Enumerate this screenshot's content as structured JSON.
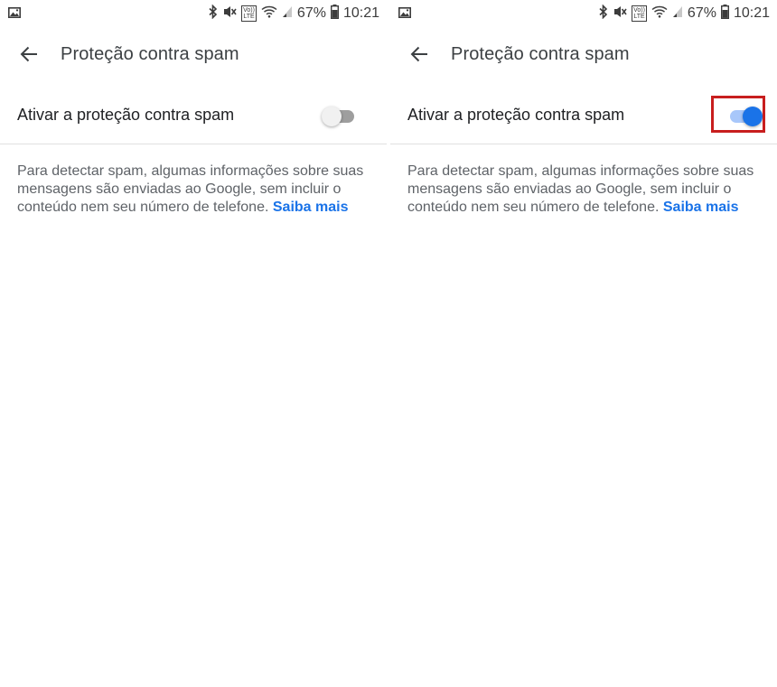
{
  "status_bar": {
    "battery_percent": "67%",
    "time": "10:21",
    "volte_top": "Vo))",
    "volte_bottom": "LTE",
    "icons": [
      "image-notification-icon",
      "bluetooth-icon",
      "mute-vibrate-icon",
      "volte-icon",
      "wifi-icon",
      "cell-signal-icon",
      "battery-icon"
    ]
  },
  "screens": [
    {
      "title": "Proteção contra spam",
      "setting_label": "Ativar a proteção contra spam",
      "toggle_state": "off",
      "description": "Para detectar spam, algumas informações sobre suas mensagens são enviadas ao Google, sem incluir o conteúdo nem seu número de telefone.",
      "learn_more": "Saiba mais"
    },
    {
      "title": "Proteção contra spam",
      "setting_label": "Ativar a proteção contra spam",
      "toggle_state": "on",
      "highlighted": true,
      "description": "Para detectar spam, algumas informações sobre suas mensagens são enviadas ao Google, sem incluir o conteúdo nem seu número de telefone.",
      "learn_more": "Saiba mais"
    }
  ],
  "colors": {
    "accent": "#1a73e8",
    "highlight_border": "#c81e1e",
    "text_primary": "#202124",
    "text_secondary": "#5f6368"
  }
}
